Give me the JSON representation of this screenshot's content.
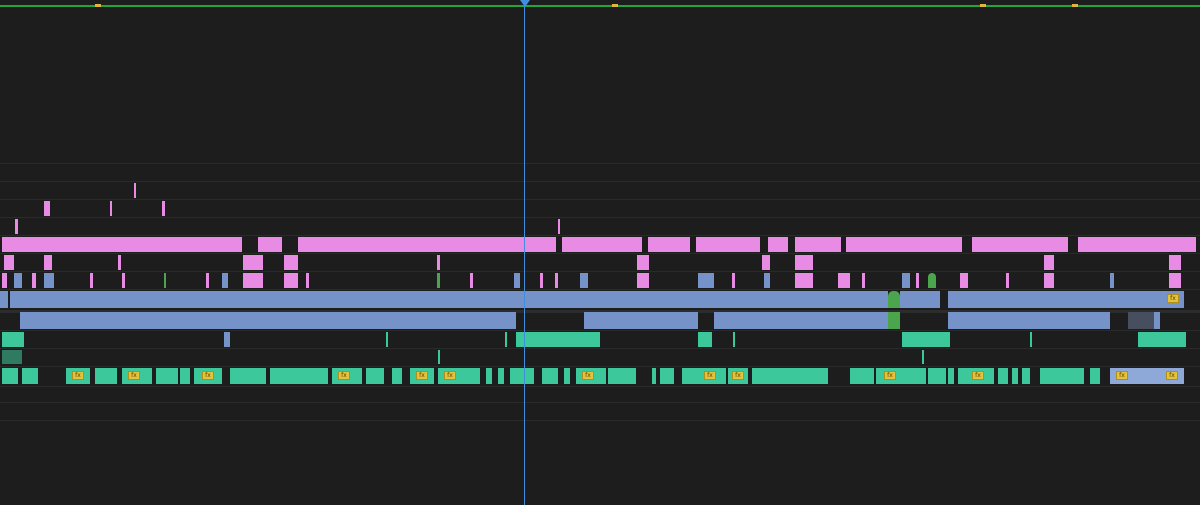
{
  "timeline": {
    "colors": {
      "background": "#1d1d1d",
      "video": "#7693c9",
      "graphics": "#e88be4",
      "audio": "#3cc89a",
      "playhead": "#3f8ee0",
      "ruler": "#21a63f",
      "fx_badge": "#e3c23c"
    },
    "fx_label": "fx",
    "icons": {
      "playhead": "playhead-icon",
      "fx_badge": "fx-badge-icon"
    }
  }
}
